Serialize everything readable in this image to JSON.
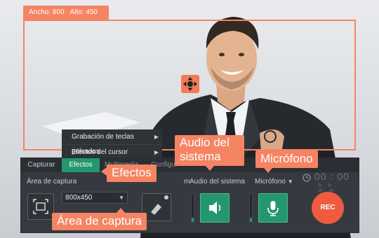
{
  "capture_frame": {
    "width_label": "Ancho: 800",
    "height_label": "Alto: 450"
  },
  "effects_menu": {
    "items": [
      {
        "label": "Grabación de teclas pulsadas"
      },
      {
        "label": "Efectos del cursor"
      }
    ]
  },
  "panel": {
    "tabs": [
      {
        "label": "Capturar"
      },
      {
        "label": "Efectos"
      },
      {
        "label": "Multimedia"
      },
      {
        "label": "Configur"
      }
    ],
    "capture_area_label": "Área de captura",
    "resolution_value": "800x450",
    "webcam_label_fragment": "m",
    "system_audio_label": "Audio del sistema",
    "microphone_label": "Micrófono",
    "timer": "00 : 00",
    "timer_units": "hh mm ss",
    "rec_label": "REC",
    "system_audio_level": 0.15,
    "microphone_level": 0.15
  },
  "callouts": {
    "efectos": "Efectos",
    "area": "Área de captura",
    "audio_line1": "Audio del",
    "audio_line2": "sistema",
    "micro": "Micrófono"
  },
  "colors": {
    "accent": "#f58463",
    "green": "#24976e",
    "rec": "#ee5b3f",
    "panel": "#363a40"
  },
  "icons": [
    "move-icon",
    "capture-area-icon",
    "webcam-icon",
    "speaker-icon",
    "microphone-icon",
    "alarm-clock-icon",
    "chevron-right-icon",
    "chevron-down-icon"
  ]
}
